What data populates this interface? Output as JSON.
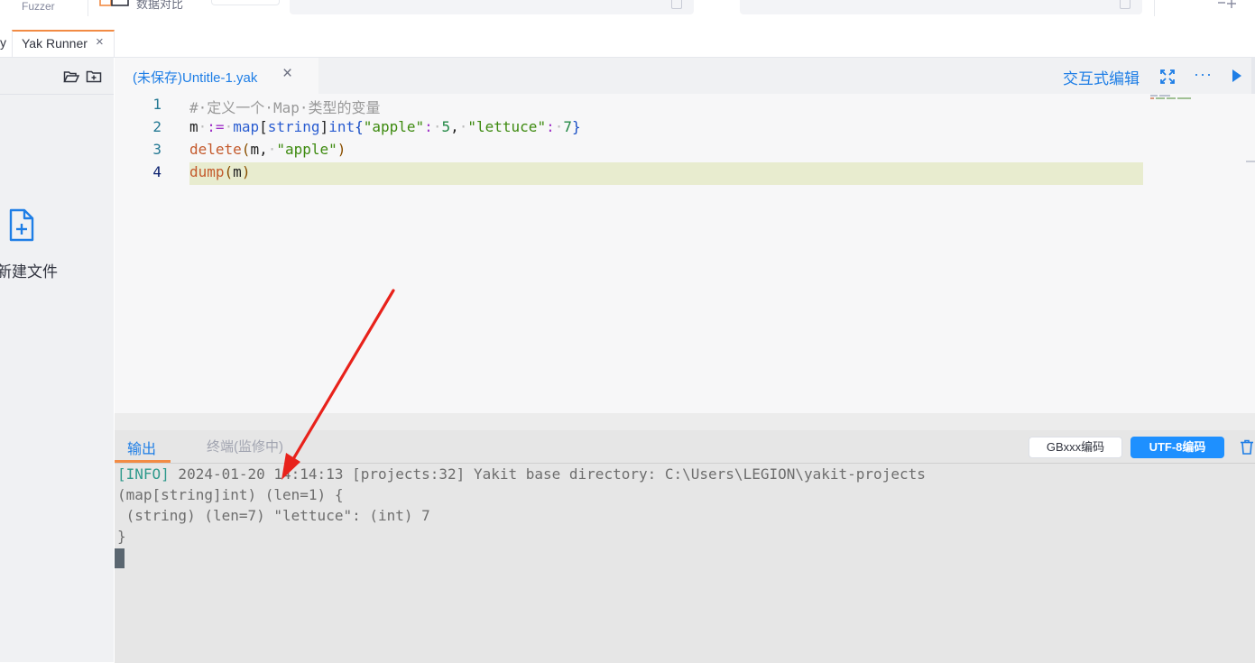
{
  "topbar": {
    "fuzzer_label": "Fuzzer",
    "doc_label": "数据对比"
  },
  "tabs": {
    "prev_tab_fragment": "y",
    "active_tab_label": "Yak Runner",
    "active_tab_close": "×"
  },
  "file_panel": {
    "new_file_label": "新建文件"
  },
  "editor": {
    "tab_label": "(未保存)Untitle-1.yak",
    "tab_close": "×",
    "interactive_edit_label": "交互式编辑",
    "more_label": "···",
    "line_numbers": [
      "1",
      "2",
      "3",
      "4"
    ],
    "code_lines": [
      "#·定义一个·Map·类型的变量",
      "m·:=·map[string]int{\"apple\":·5,·\"lettuce\":·7}",
      "delete(m,·\"apple\")",
      "dump(m)"
    ],
    "current_line": 4
  },
  "output": {
    "tab_output": "输出",
    "tab_terminal": "终端(监修中)",
    "gbk_button": "GBxxx编码",
    "utf8_button": "UTF-8编码",
    "info_tag": "[INFO]",
    "lines": [
      " 2024-01-20 14:14:13 [projects:32] Yakit base directory: C:\\Users\\LEGION\\yakit-projects",
      "(map[string]int) (len=1) {",
      " (string) (len=7) \"lettuce\": (int) 7",
      "}"
    ]
  },
  "colors": {
    "accent_blue": "#1e7ee6",
    "tab_accent_orange": "#f28b44",
    "annotation_red": "#e8221b",
    "current_line_bg": "#e8eccf"
  }
}
